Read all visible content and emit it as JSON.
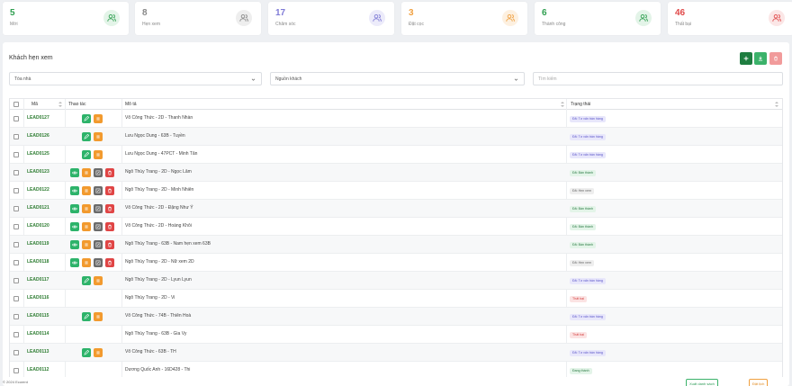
{
  "stats": [
    {
      "value": "5",
      "label": "Mới",
      "color": "#2e9e4f",
      "bg": "#e3f4e8",
      "icon": "users-icon"
    },
    {
      "value": "8",
      "label": "Hẹn xem",
      "color": "#888888",
      "bg": "#eeeeee",
      "icon": "users-icon"
    },
    {
      "value": "17",
      "label": "Chăm sóc",
      "color": "#7f7bd6",
      "bg": "#ecebfa",
      "icon": "users-icon"
    },
    {
      "value": "3",
      "label": "Đặt cọc",
      "color": "#f0a040",
      "bg": "#fdf0e0",
      "icon": "users-icon"
    },
    {
      "value": "6",
      "label": "Thành công",
      "color": "#2e9e4f",
      "bg": "#e3f4e8",
      "icon": "users-icon"
    },
    {
      "value": "46",
      "label": "Thất bại",
      "color": "#e04848",
      "bg": "#fbe6e6",
      "icon": "users-icon"
    }
  ],
  "panel": {
    "title": "Khách hẹn xem",
    "toolbar": [
      {
        "icon": "plus-icon",
        "color": "#1e7d40"
      },
      {
        "icon": "download-icon",
        "color": "#3bb26a"
      },
      {
        "icon": "trash-icon",
        "color": "#f19b9b"
      }
    ]
  },
  "filters": {
    "building": "Tòa nhà",
    "source": "Nguồn khách",
    "search_placeholder": "Tìm kiếm"
  },
  "columns": {
    "code": "Mã",
    "actions": "Thao tác",
    "description": "Mô tả",
    "status": "Trạng thái"
  },
  "status_styles": {
    "Đã: Tư vấn bán hàng": {
      "bg": "#e8e7fb",
      "fg": "#5b55c9"
    },
    "Đã: Hẹn xem": {
      "bg": "#eeeeee",
      "fg": "#666666"
    },
    "Đã: Đặt cọc": {
      "bg": "#fdf0e0",
      "fg": "#c77a1e"
    },
    "Đã: Bán thành": {
      "bg": "#e3f4e8",
      "fg": "#2a7a43"
    },
    "Thất bại": {
      "bg": "#fbe3e3",
      "fg": "#d43c3c"
    },
    "Đang thành": {
      "bg": "#e3f4e8",
      "fg": "#2a7a43"
    }
  },
  "action_colors": {
    "eye": "#2db36a",
    "edit": "#2db36a",
    "pause": "#f29a2e",
    "note": "#6b6b6b",
    "delete": "#e04545"
  },
  "rows": [
    {
      "code": "LEAD0127",
      "actions": [
        "edit",
        "pause"
      ],
      "description": "Võ Công Thức - 2D - Thanh Nhàn",
      "status": "Đã: Tư vấn bán hàng"
    },
    {
      "code": "LEAD0126",
      "actions": [
        "edit",
        "pause"
      ],
      "description": "Lưu Ngọc Dung - 63B - Tuyền",
      "status": "Đã: Tư vấn bán hàng"
    },
    {
      "code": "LEAD0125",
      "actions": [
        "edit",
        "pause"
      ],
      "description": "Lưu Ngọc Dung - 47PCT - Minh Tân",
      "status": "Đã: Tư vấn bán hàng"
    },
    {
      "code": "LEAD0123",
      "actions": [
        "eye",
        "pause",
        "note",
        "delete"
      ],
      "description": "Ngô Thùy Trang - 2D - Ngọc Lâm",
      "status": "Đã: Bán thành"
    },
    {
      "code": "LEAD0122",
      "actions": [
        "eye",
        "pause",
        "note",
        "delete"
      ],
      "description": "Ngô Thùy Trang - 2D - Minh Nhiên",
      "status": "Đã: Hẹn xem"
    },
    {
      "code": "LEAD0121",
      "actions": [
        "eye",
        "pause",
        "note",
        "delete"
      ],
      "description": "Võ Công Thức - 2D - Đặng Như Ý",
      "status": "Đã: Bán thành"
    },
    {
      "code": "LEAD0120",
      "actions": [
        "eye",
        "pause",
        "note",
        "delete"
      ],
      "description": "Võ Công Thức - 2D - Hoàng Khôi",
      "status": "Đã: Bán thành"
    },
    {
      "code": "LEAD0119",
      "actions": [
        "eye",
        "pause",
        "note",
        "delete"
      ],
      "description": "Ngô Thùy Trang - 63B - Nam hẹn xem 63B",
      "status": "Đã: Bán thành"
    },
    {
      "code": "LEAD0118",
      "actions": [
        "eye",
        "pause",
        "note",
        "delete"
      ],
      "description": "Ngô Thùy Trang - 2D - Nữ xem 2D",
      "status": "Đã: Hẹn xem"
    },
    {
      "code": "LEAD0117",
      "actions": [
        "edit",
        "pause"
      ],
      "description": "Ngô Thùy Trang - 2D - Lyun Lyun",
      "status": "Đã: Tư vấn bán hàng"
    },
    {
      "code": "LEAD0116",
      "actions": [],
      "description": "Ngô Thùy Trang - 2D - Vi",
      "status": "Thất bại"
    },
    {
      "code": "LEAD0115",
      "actions": [
        "edit",
        "pause"
      ],
      "description": "Võ Công Thức - 74B - Thiên Hoà",
      "status": "Đã: Tư vấn bán hàng"
    },
    {
      "code": "LEAD0114",
      "actions": [],
      "description": "Ngô Thùy Trang - 63B - Gia Vy",
      "status": "Thất bại"
    },
    {
      "code": "LEAD0113",
      "actions": [
        "edit",
        "pause"
      ],
      "description": "Võ Công Thức - 63B - TH",
      "status": "Đã: Tư vấn bán hàng"
    },
    {
      "code": "LEAD0112",
      "actions": [],
      "description": "Dương Quốc Anh - 16D428 - Thi",
      "status": "Đang thành"
    }
  ],
  "footer": {
    "copyright": "© 2024 Ecorent",
    "btn_left": "Xuất danh sách",
    "btn_right": "Đặt lịch"
  }
}
